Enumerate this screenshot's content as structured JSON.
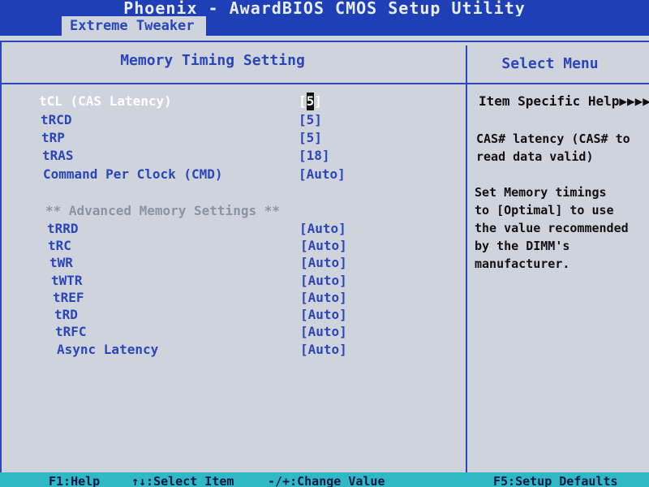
{
  "app": {
    "title": "Phoenix - AwardBIOS CMOS Setup Utility"
  },
  "menu": {
    "active_tab": "Extreme Tweaker"
  },
  "main": {
    "header": "Memory Timing Setting",
    "items": [
      {
        "label": "tCL (CAS Latency)",
        "value_open": "[",
        "value_cursor": "5",
        "value_close": "]",
        "selected": true
      },
      {
        "label": "tRCD",
        "value": "[5]"
      },
      {
        "label": "tRP",
        "value": "[5]"
      },
      {
        "label": "tRAS",
        "value": "[18]"
      },
      {
        "label": "Command Per Clock (CMD)",
        "value": "[Auto]"
      }
    ],
    "advanced_heading": "** Advanced Memory Settings **",
    "advanced_items": [
      {
        "label": "tRRD",
        "value": "[Auto]"
      },
      {
        "label": "tRC",
        "value": "[Auto]"
      },
      {
        "label": "tWR",
        "value": "[Auto]"
      },
      {
        "label": "tWTR",
        "value": "[Auto]"
      },
      {
        "label": "tREF",
        "value": "[Auto]"
      },
      {
        "label": "tRD",
        "value": "[Auto]"
      },
      {
        "label": "tRFC",
        "value": "[Auto]"
      },
      {
        "label": "Async Latency",
        "value": "[Auto]"
      }
    ]
  },
  "side": {
    "header": "Select Menu",
    "help_title": "Item Specific Help▶▶▶▶",
    "help_lines_1": [
      "CAS# latency (CAS# to",
      "read data valid)"
    ],
    "help_lines_2": [
      "Set Memory timings",
      "to [Optimal] to use",
      "the value recommended",
      "by the DIMM's",
      "manufacturer."
    ]
  },
  "footer": {
    "f1": "F1:Help",
    "select": "↑↓:Select Item",
    "change": "-/+:Change Value",
    "f5": "F5:Setup Defaults"
  },
  "colors": {
    "bios_blue": "#2a46b8",
    "background": "#cfd4dc",
    "footer": "#2fb8c6"
  }
}
